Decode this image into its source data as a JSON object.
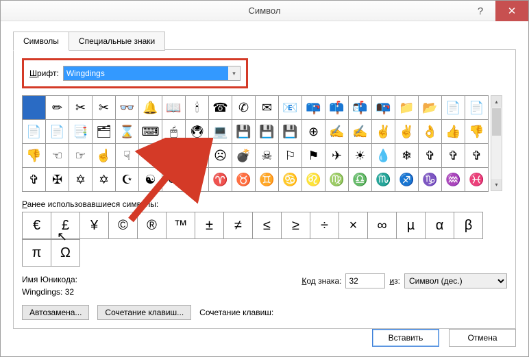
{
  "window": {
    "title": "Символ",
    "help_icon": "?",
    "close_icon": "✕"
  },
  "tabs": {
    "symbols": "Символы",
    "special": "Специальные знаки"
  },
  "font": {
    "label_pre": "Ш",
    "label_rest": "рифт:",
    "value": "Wingdings"
  },
  "grid": {
    "rows": [
      [
        "",
        "✏",
        "✂",
        "✂",
        "👓",
        "🔔",
        "📖",
        "🕯",
        "☎",
        "✆",
        "✉",
        "📧",
        "📪",
        "📫",
        "📬",
        "📭",
        "📁",
        "📂",
        "📄",
        "📄"
      ],
      [
        "📄",
        "📄",
        "📑",
        "🗂",
        "⌛",
        "⌨",
        "🖱",
        "🖲",
        "💻",
        "💾",
        "💾",
        "💾",
        "⊕",
        "✍",
        "✍",
        "✌",
        "✌",
        "👌",
        "👍",
        "👎"
      ],
      [
        "👎",
        "☜",
        "☞",
        "☝",
        "☟",
        "✋",
        "☺",
        "☺",
        "☹",
        "💣",
        "☠",
        "⚐",
        "⚑",
        "✈",
        "☀",
        "💧",
        "❄",
        "✞",
        "✞",
        "✞"
      ],
      [
        "✞",
        "✠",
        "✡",
        "✡",
        "☪",
        "☯",
        "ॐ",
        "☸",
        "♈",
        "♉",
        "♊",
        "♋",
        "♌",
        "♍",
        "♎",
        "♏",
        "♐",
        "♑",
        "♒",
        "♓"
      ]
    ],
    "selected": [
      0,
      0
    ]
  },
  "recent": {
    "label_pre": "Р",
    "label_rest": "анее использовавшиеся символы",
    "items": [
      "€",
      "£",
      "¥",
      "©",
      "®",
      "™",
      "±",
      "≠",
      "≤",
      "≥",
      "÷",
      "×",
      "∞",
      "µ",
      "α",
      "β",
      "π",
      "Ω"
    ]
  },
  "info": {
    "name_label": "Имя Юникода:",
    "code_line": "Wingdings: 32"
  },
  "code": {
    "label_pre": "К",
    "label_rest": "од знака:",
    "value": "32"
  },
  "from": {
    "label_pre": "и",
    "label_rest": "з:",
    "value": "Символ (дес.)"
  },
  "buttons": {
    "autocorrect": "Автозамена...",
    "shortcut": "Сочетание клавиш...",
    "shortcut_label": "Сочетание клавиш:"
  },
  "footer": {
    "insert": "Вставить",
    "cancel": "Отмена"
  }
}
